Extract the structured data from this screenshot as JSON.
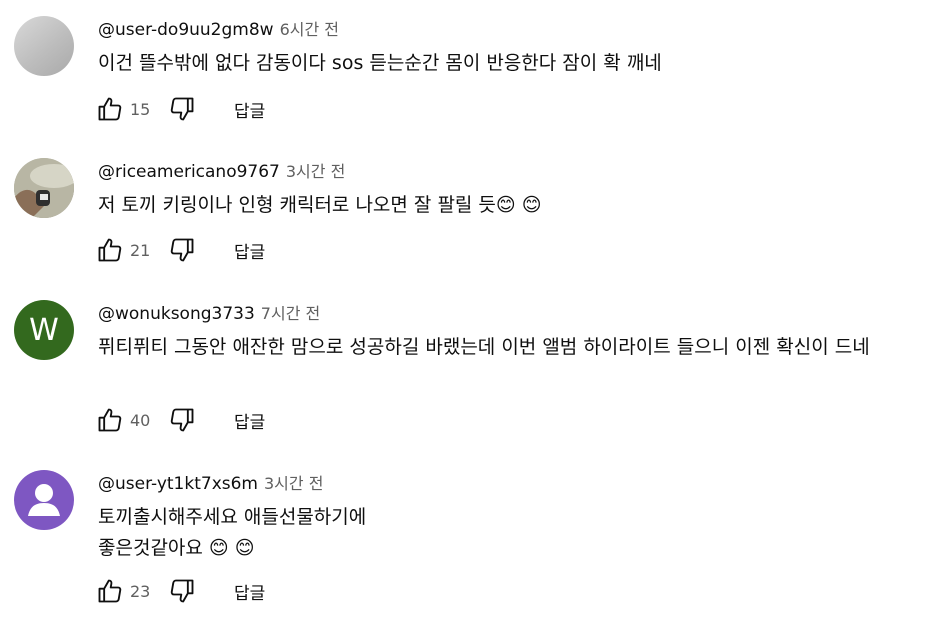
{
  "comments": [
    {
      "author": "@user-do9uu2gm8w",
      "time": "6시간 전",
      "text": "이건 뜰수밖에 없다 감동이다 sos 듣는순간 몸이 반응한다 잠이 확 깨네",
      "likes": "15",
      "reply_label": "답글",
      "avatar_type": "gray-photo",
      "avatar_letter": ""
    },
    {
      "author": "@riceamericano9767",
      "time": "3시간 전",
      "text": "저 토끼 키링이나 인형 캐릭터로 나오면 잘 팔릴 듯😊 😊",
      "likes": "21",
      "reply_label": "답글",
      "avatar_type": "photo",
      "avatar_letter": ""
    },
    {
      "author": "@wonuksong3733",
      "time": "7시간 전",
      "text": "퓌티퓌티 그동안 애잔한 맘으로 성공하길 바랬는데 이번 앨범 하이라이트 들으니 이젠 확신이 드네",
      "likes": "40",
      "reply_label": "답글",
      "avatar_type": "letter",
      "avatar_letter": "W"
    },
    {
      "author": "@user-yt1kt7xs6m",
      "time": "3시간 전",
      "text": "토끼출시해주세요 애들선물하기에\n좋은것같아요 😊 😊",
      "likes": "23",
      "reply_label": "답글",
      "avatar_type": "default-person",
      "avatar_letter": ""
    }
  ],
  "colors": {
    "text": "#0f0f0f",
    "secondary": "#606060",
    "avatar_w": "#33691e",
    "avatar_purple": "#7e57c2"
  }
}
